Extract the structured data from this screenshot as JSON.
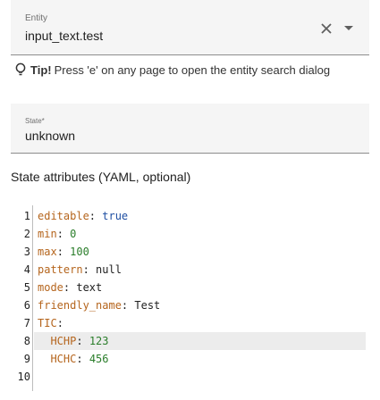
{
  "entity": {
    "label": "Entity",
    "value": "input_text.test"
  },
  "tip": {
    "label": "Tip!",
    "text": "Press 'e' on any page to open the entity search dialog"
  },
  "state": {
    "label": "State*",
    "value": "unknown"
  },
  "attributes": {
    "title": "State attributes (YAML, optional)"
  },
  "editor": {
    "line_numbers": [
      "1",
      "2",
      "3",
      "4",
      "5",
      "6",
      "7",
      "8",
      "9",
      "10"
    ],
    "lines": [
      {
        "key": "editable",
        "sep": ": ",
        "value": "true",
        "vtype": "bool",
        "indent": ""
      },
      {
        "key": "min",
        "sep": ": ",
        "value": "0",
        "vtype": "num",
        "indent": ""
      },
      {
        "key": "max",
        "sep": ": ",
        "value": "100",
        "vtype": "num",
        "indent": ""
      },
      {
        "key": "pattern",
        "sep": ": ",
        "value": "null",
        "vtype": "plain",
        "indent": ""
      },
      {
        "key": "mode",
        "sep": ": ",
        "value": "text",
        "vtype": "plain",
        "indent": ""
      },
      {
        "key": "friendly_name",
        "sep": ": ",
        "value": "Test",
        "vtype": "plain",
        "indent": ""
      },
      {
        "key": "TIC",
        "sep": ":",
        "value": "",
        "vtype": "plain",
        "indent": ""
      },
      {
        "key": "HCHP",
        "sep": ": ",
        "value": "123",
        "vtype": "num",
        "indent": "  "
      },
      {
        "key": "HCHC",
        "sep": ": ",
        "value": "456",
        "vtype": "num",
        "indent": "  "
      },
      {
        "key": "",
        "sep": "",
        "value": "",
        "vtype": "plain",
        "indent": ""
      }
    ],
    "active_line": 8
  },
  "colors": {
    "key": "#b5651d",
    "bool": "#1f4fa3",
    "number": "#2a7d2a"
  },
  "icons": {
    "clear": "close-icon",
    "dropdown": "chevron-down-icon",
    "tip": "lightbulb-icon"
  }
}
